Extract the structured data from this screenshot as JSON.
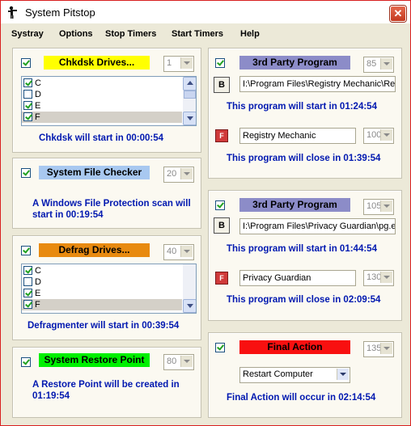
{
  "window": {
    "title": "System Pitstop"
  },
  "menu": [
    "Systray",
    "Options",
    "Stop Timers",
    "Start Timers",
    "Help"
  ],
  "chkdsk": {
    "label": "Chkdsk Drives...",
    "spin": "1",
    "drives": [
      {
        "letter": "C",
        "checked": true
      },
      {
        "letter": "D",
        "checked": false
      },
      {
        "letter": "E",
        "checked": true
      },
      {
        "letter": "F",
        "checked": true
      }
    ],
    "status": "Chkdsk will start in 00:00:54"
  },
  "sfc": {
    "label": "System File Checker",
    "spin": "20",
    "status": "A Windows File Protection scan will start in 00:19:54"
  },
  "defrag": {
    "label": "Defrag Drives...",
    "spin": "40",
    "drives": [
      {
        "letter": "C",
        "checked": true
      },
      {
        "letter": "D",
        "checked": false
      },
      {
        "letter": "E",
        "checked": true
      },
      {
        "letter": "F",
        "checked": true
      }
    ],
    "status": "Defragmenter will start in 00:39:54"
  },
  "restore": {
    "label": "System Restore Point",
    "spin": "80",
    "status": "A Restore Point will be created in 01:19:54"
  },
  "party1": {
    "label": "3rd Party Program",
    "spin": "85",
    "browse": "B",
    "path": "I:\\Program Files\\Registry Mechanic\\Re",
    "start_status": "This program will start in 01:24:54",
    "close_name": "Registry Mechanic",
    "close_spin": "100",
    "close_status": "This program will close in 01:39:54"
  },
  "party2": {
    "label": "3rd Party Program",
    "spin": "105",
    "browse": "B",
    "path": "I:\\Program Files\\Privacy Guardian\\pg.e",
    "start_status": "This program will start in 01:44:54",
    "close_name": "Privacy Guardian",
    "close_spin": "130",
    "close_status": "This program will close in 02:09:54"
  },
  "final": {
    "label": "Final Action",
    "spin": "135",
    "action": "Restart Computer",
    "status": "Final Action will occur in 02:14:54"
  },
  "colors": {
    "chkdsk_tag": "#ffff00",
    "sfc_tag": "#a8c8f0",
    "defrag_tag": "#e88a10",
    "restore_tag": "#00f000",
    "party_tag": "#8c8cc8",
    "final_tag": "#f81010",
    "status_text": "#0018b0"
  },
  "icons": {
    "app": "pitstop-figure-icon",
    "close": "close-x-icon",
    "kill": "stop-process-icon"
  }
}
